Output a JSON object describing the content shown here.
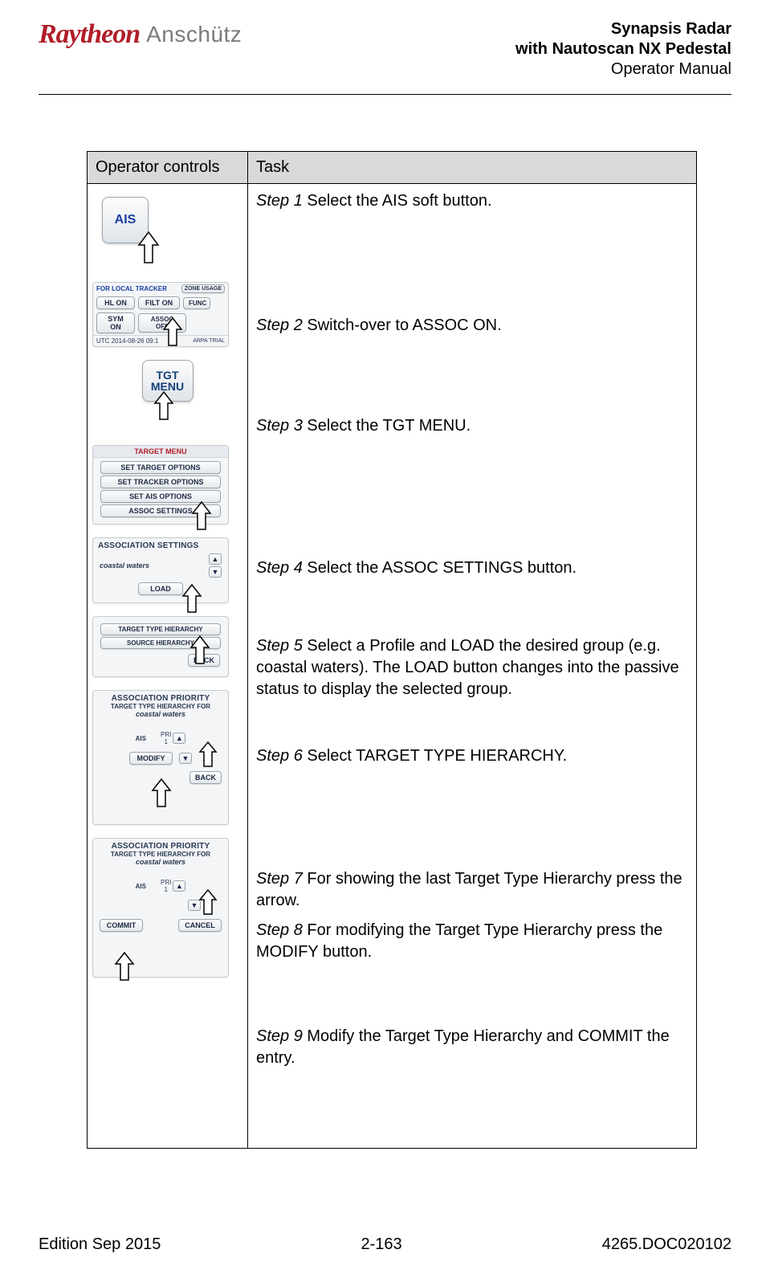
{
  "header": {
    "logo_main": "Raytheon",
    "logo_sub": "Anschütz",
    "line1": "Synapsis Radar",
    "line2": "with Nautoscan NX Pedestal",
    "line3": "Operator Manual"
  },
  "table": {
    "col_op": "Operator controls",
    "col_task": "Task"
  },
  "ui": {
    "ais": "AIS",
    "tracker_label": "FOR LOCAL TRACKER",
    "zone_usage": "ZONE USAGE",
    "hl_on": "HL ON",
    "filt_on": "FILT ON",
    "sym_on": "SYM ON",
    "assoc_off": "ASSOC OFF",
    "func": "FUNC",
    "arpa_trial": "ARPA TRIAL",
    "utc_row": "UTC   2014-08-26  09:1",
    "tgt_menu": "TGT MENU",
    "target_menu_title": "TARGET MENU",
    "set_target_options": "SET TARGET OPTIONS",
    "set_tracker_options": "SET TRACKER OPTIONS",
    "set_ais_options": "SET AIS OPTIONS",
    "assoc_settings": "ASSOC SETTINGS",
    "assoc_settings_title": "ASSOCIATION SETTINGS",
    "coastal_waters": "coastal waters",
    "load": "LOAD",
    "tth": "TARGET TYPE HIERARCHY",
    "source_hierarchy": "SOURCE HIERARCHY",
    "back": "BACK",
    "assoc_priority": "ASSOCIATION PRIORITY",
    "tth_for": "TARGET TYPE HIERARCHY FOR",
    "ais_label": "AIS",
    "prio_short": "PRI",
    "one": "1",
    "modify": "MODIFY",
    "commit": "COMMIT",
    "cancel": "CANCEL"
  },
  "steps": {
    "s1_label": "Step 1",
    "s1_text": " Select the AIS soft button.",
    "s2_label": "Step 2",
    "s2_text": " Switch-over to ASSOC ON.",
    "s3_label": "Step 3",
    "s3_text": " Select the TGT MENU.",
    "s4_label": "Step 4",
    "s4_text": " Select the ASSOC SETTINGS button.",
    "s5_label": "Step 5",
    "s5_text": " Select a Profile and LOAD the desired group (e.g. coastal waters). The LOAD button changes into the passive status to display the selected group.",
    "s6_label": "Step 6",
    "s6_text": " Select TARGET TYPE HIERARCHY.",
    "s7_label": "Step 7",
    "s7_text": " For showing the last Target Type Hierarchy press the arrow.",
    "s8_label": "Step 8",
    "s8_text": " For modifying the Target Type Hierarchy press the MODIFY button.",
    "s9_label": "Step 9",
    "s9_text": " Modify the Target Type Hierarchy and COMMIT the entry."
  },
  "footer": {
    "left": "Edition Sep 2015",
    "center": "2-163",
    "right": "4265.DOC020102"
  }
}
